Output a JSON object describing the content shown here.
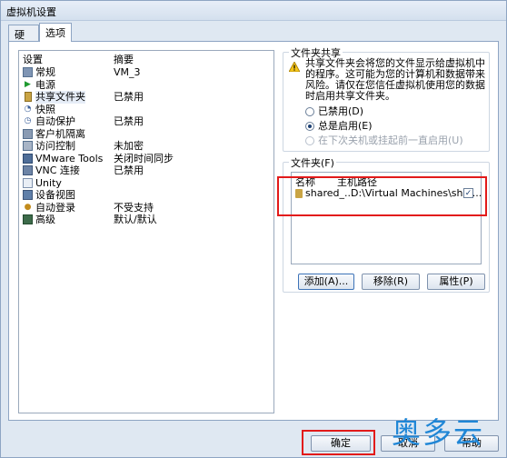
{
  "window": {
    "title": "虚拟机设置"
  },
  "tabs": [
    {
      "label": "硬件"
    },
    {
      "label": "选项"
    }
  ],
  "settings": {
    "header": {
      "setting": "设置",
      "summary": "摘要"
    },
    "items": [
      {
        "name": "常规",
        "summary": "VM_3",
        "icon": "general-icon"
      },
      {
        "name": "电源",
        "summary": "",
        "icon": "power-icon"
      },
      {
        "name": "共享文件夹",
        "summary": "已禁用",
        "icon": "shared-folders-icon"
      },
      {
        "name": "快照",
        "summary": "",
        "icon": "snapshot-icon"
      },
      {
        "name": "自动保护",
        "summary": "已禁用",
        "icon": "autoprotect-icon"
      },
      {
        "name": "客户机隔离",
        "summary": "",
        "icon": "isolation-icon"
      },
      {
        "name": "访问控制",
        "summary": "未加密",
        "icon": "access-control-icon"
      },
      {
        "name": "VMware Tools",
        "summary": "关闭时间同步",
        "icon": "vmware-tools-icon"
      },
      {
        "name": "VNC 连接",
        "summary": "已禁用",
        "icon": "vnc-icon"
      },
      {
        "name": "Unity",
        "summary": "",
        "icon": "unity-icon"
      },
      {
        "name": "设备视图",
        "summary": "",
        "icon": "device-view-icon"
      },
      {
        "name": "自动登录",
        "summary": "不受支持",
        "icon": "autologin-icon"
      },
      {
        "name": "高级",
        "summary": "默认/默认",
        "icon": "advanced-icon"
      }
    ]
  },
  "folder_sharing": {
    "legend": "文件夹共享",
    "warning": "共享文件夹会将您的文件显示给虚拟机中的程序。这可能为您的计算机和数据带来风险。请仅在您信任虚拟机使用您的数据时启用共享文件夹。",
    "options": [
      {
        "label": "已禁用(D)",
        "selected": false,
        "disabled": false
      },
      {
        "label": "总是启用(E)",
        "selected": true,
        "disabled": false
      },
      {
        "label": "在下次关机或挂起前一直启用(U)",
        "selected": false,
        "disabled": true
      }
    ]
  },
  "folders": {
    "legend": "文件夹(F)",
    "col_name": "名称",
    "col_path": "主机路径",
    "rows": [
      {
        "name": "shared_...",
        "path": "D:\\Virtual Machines\\shar...",
        "checked": "✓"
      }
    ],
    "add": "添加(A)...",
    "remove": "移除(R)",
    "properties": "属性(P)"
  },
  "footer": {
    "ok": "确定",
    "cancel": "取消",
    "help": "帮助"
  },
  "watermark": "奥多云",
  "colors": {
    "highlight_red": "#e21a1a",
    "accent_blue": "#3d73b8"
  }
}
